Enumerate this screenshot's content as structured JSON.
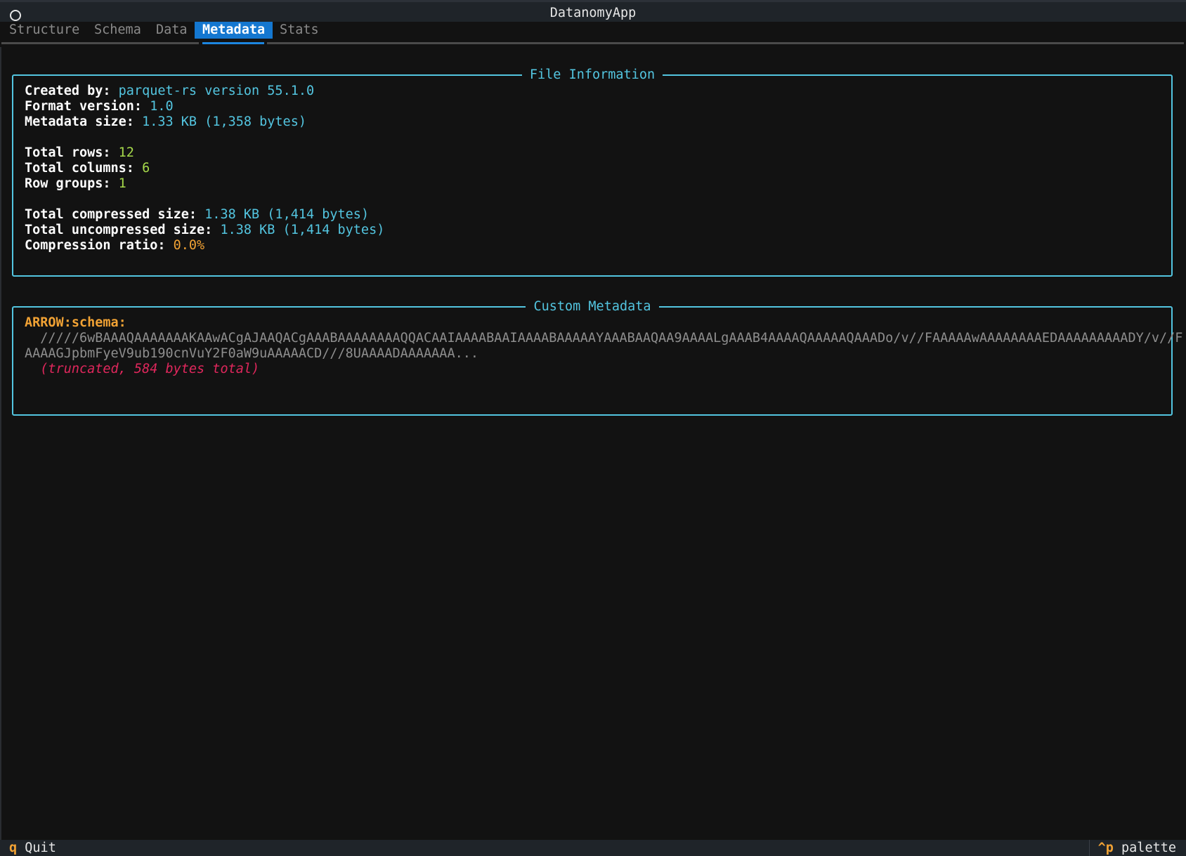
{
  "app": {
    "title": "DatanomyApp"
  },
  "tabs": [
    {
      "label": "Structure",
      "active": false
    },
    {
      "label": "Schema",
      "active": false
    },
    {
      "label": "Data",
      "active": false
    },
    {
      "label": "Metadata",
      "active": true
    },
    {
      "label": "Stats",
      "active": false
    }
  ],
  "file_info": {
    "title": "File Information",
    "created_by_label": "Created by:",
    "created_by": "parquet-rs version 55.1.0",
    "format_version_label": "Format version:",
    "format_version": "1.0",
    "metadata_size_label": "Metadata size:",
    "metadata_size": "1.33 KB (1,358 bytes)",
    "total_rows_label": "Total rows:",
    "total_rows": "12",
    "total_columns_label": "Total columns:",
    "total_columns": "6",
    "row_groups_label": "Row groups:",
    "row_groups": "1",
    "compressed_label": "Total compressed size:",
    "compressed": "1.38 KB (1,414 bytes)",
    "uncompressed_label": "Total uncompressed size:",
    "uncompressed": "1.38 KB (1,414 bytes)",
    "ratio_label": "Compression ratio:",
    "ratio": "0.0%"
  },
  "custom_metadata": {
    "title": "Custom Metadata",
    "key": "ARROW:schema:",
    "value_line1": "  /////6wBAAAQAAAAAAAKAAwACgAJAAQACgAAABAAAAAAAAQQACAAIAAAABAAIAAAABAAAAAYAAABAAQAA9AAAALgAAAB4AAAAQAAAAAQAAADo/v//FAAAAAwAAAAAAAAEDAAAAAAAAADY/v//F",
    "value_line2": "AAAAGJpbmFyeV9ub190cnVuY2F0aW9uAAAAACD///8UAAAADAAAAAAA...",
    "truncated_note": "  (truncated, 584 bytes total)"
  },
  "footer": {
    "quit_key": "q",
    "quit_label": " Quit",
    "palette_key": "^p",
    "palette_label": " palette"
  },
  "colors": {
    "accent_cyan": "#53c5e0",
    "accent_green": "#a6d94b",
    "accent_orange": "#f1a234",
    "tab_active_bg": "#1477d0",
    "error_red": "#e0275c",
    "background": "#121212"
  },
  "icons": {
    "window": "circle-icon"
  }
}
